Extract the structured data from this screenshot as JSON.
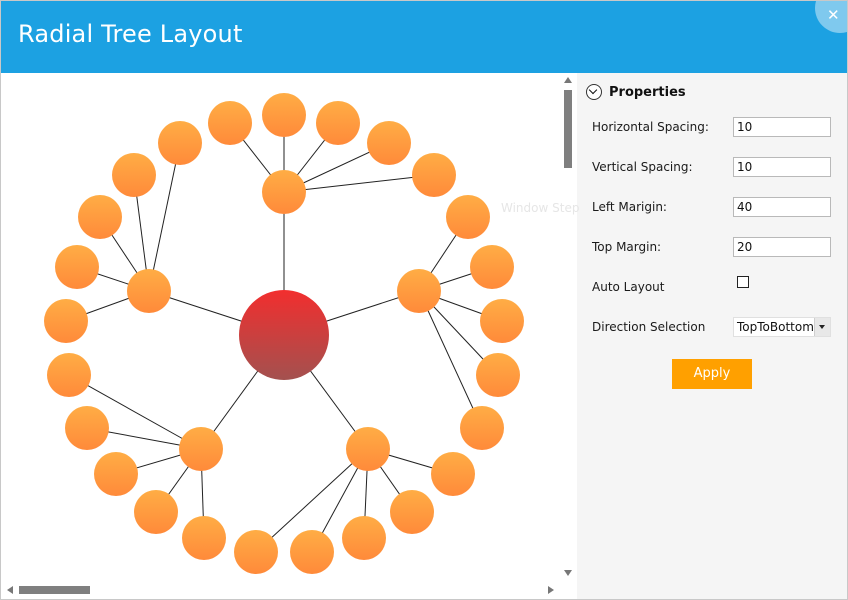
{
  "window": {
    "title": "Radial Tree Layout",
    "close_glyph": "✕",
    "accent_color": "#1ca1e2"
  },
  "diagram": {
    "root": {
      "color_top": "#f22e2e",
      "color_bottom": "#a3514f"
    },
    "node_color_top": "#ffad45",
    "node_color_bottom": "#ff8a3a",
    "branches": [
      {
        "name": "top",
        "children": 5
      },
      {
        "name": "right",
        "children": 5
      },
      {
        "name": "bottom-right",
        "children": 5
      },
      {
        "name": "bottom-left",
        "children": 5
      },
      {
        "name": "left",
        "children": 5
      }
    ]
  },
  "properties": {
    "header": "Properties",
    "horizontal_spacing": {
      "label": "Horizontal Spacing:",
      "value": "10"
    },
    "vertical_spacing": {
      "label": "Vertical Spacing:",
      "value": "10"
    },
    "left_margin": {
      "label": "Left Marigin:",
      "value": "40"
    },
    "top_margin": {
      "label": "Top Margin:",
      "value": "20"
    },
    "auto_layout": {
      "label": "Auto Layout",
      "checked": false
    },
    "direction": {
      "label": "Direction Selection",
      "value": "TopToBottom"
    },
    "apply_label": "Apply",
    "apply_color": "#ffa000"
  },
  "watermark": "Window Step"
}
